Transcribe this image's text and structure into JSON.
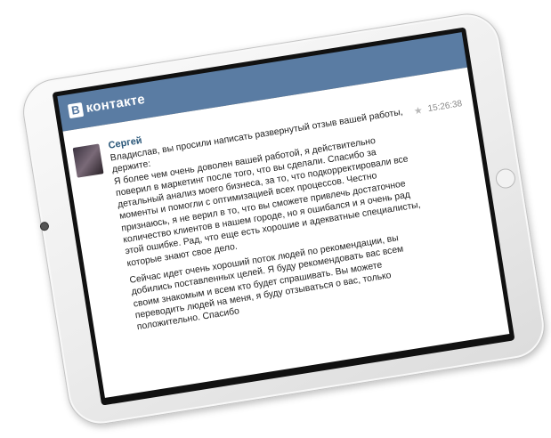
{
  "app": {
    "logo_mark": "В",
    "logo_text": "контакте",
    "brand_color": "#5a7ca3"
  },
  "message": {
    "sender": "Сергей",
    "time": "15:26:38",
    "star_icon": "star-icon",
    "lines": [
      "Владислав, вы просили написать развернутый отзыв вашей работы,",
      "держите:",
      "Я более чем очень доволен вашей работой, я действительно",
      "поверил в маркетинг после того, что вы сделали. Спасибо за",
      "детальный анализ моего бизнеса, за то, что подкорректировали все",
      "моменты и помогли с оптимизацией всех процессов. Честно",
      "признаюсь, я не верил в то, что вы сможете привлечь достаточное",
      "количество клиентов в нашем городе, но я ошибался и я очень рад",
      "этой ошибке. Рад, что еще есть хорошие и адекватные специалисты,",
      "которые знают свое дело.",
      "Сейчас идет очень хороший поток людей по рекомендации, вы",
      "добились поставленных целей. Я буду рекомендовать вас всем",
      "своим знакомым и всем кто будет спрашивать. Вы можете",
      "переводить людей на меня, я буду отзываться о вас, только",
      "положительно. Спасибо"
    ]
  }
}
